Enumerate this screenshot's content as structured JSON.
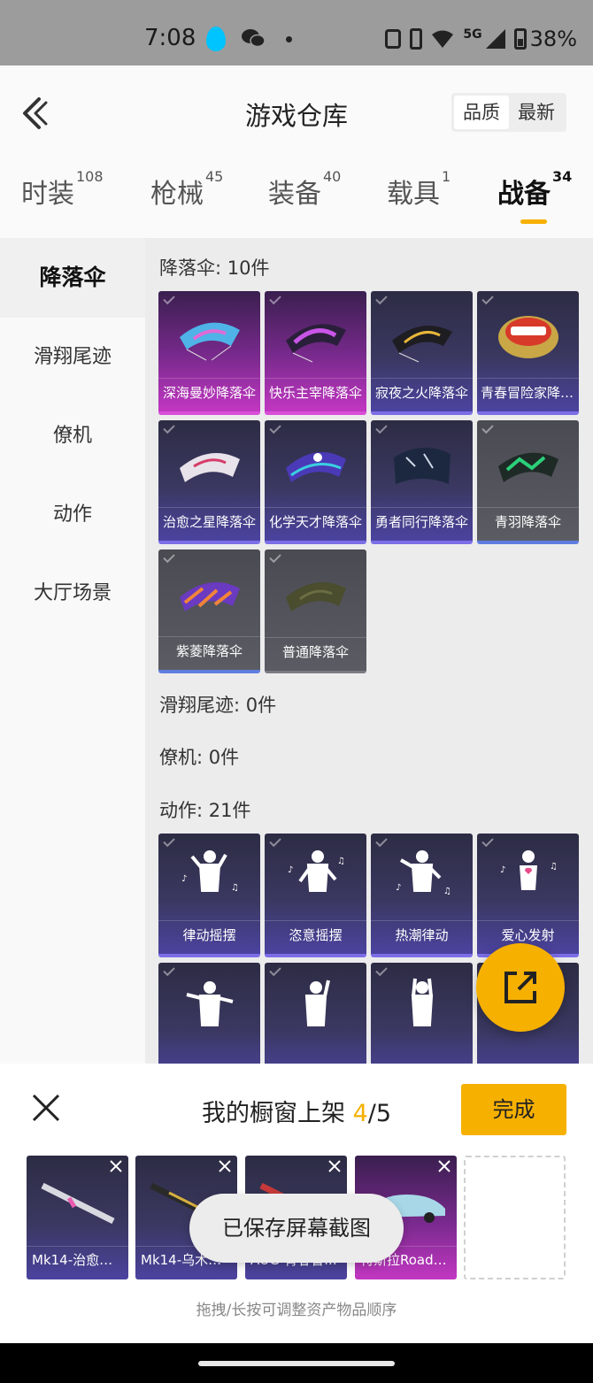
{
  "status_bar": {
    "time": "7:08",
    "network": "5G",
    "battery": "38%"
  },
  "header": {
    "title": "游戏仓库",
    "sort_options": [
      "品质",
      "最新"
    ],
    "selected_sort": "品质"
  },
  "tabs": [
    {
      "label": "时装",
      "count": "108"
    },
    {
      "label": "枪械",
      "count": "45"
    },
    {
      "label": "装备",
      "count": "40"
    },
    {
      "label": "载具",
      "count": "1"
    },
    {
      "label": "战备",
      "count": "34"
    }
  ],
  "active_tab": "战备",
  "sidebar": {
    "items": [
      "降落伞",
      "滑翔尾迹",
      "僚机",
      "动作",
      "大厅场景"
    ],
    "active": "降落伞"
  },
  "sections": {
    "parachute": {
      "title": "降落伞: 10件",
      "items": [
        "深海曼妙降落伞",
        "快乐主宰降落伞",
        "寂夜之火降落伞",
        "青春冒险家降落伞",
        "治愈之星降落伞",
        "化学天才降落伞",
        "勇者同行降落伞",
        "青羽降落伞",
        "紫菱降落伞",
        "普通降落伞"
      ]
    },
    "glide_trail": {
      "title": "滑翔尾迹: 0件"
    },
    "wingman": {
      "title": "僚机: 0件"
    },
    "emote": {
      "title": "动作: 21件",
      "items": [
        "律动摇摆",
        "恣意摇摆",
        "热潮律动",
        "爱心发射"
      ]
    }
  },
  "colors": {
    "accent": "#f6b000",
    "card_purple": "#4b43a0",
    "card_pink": "#c237c2",
    "card_gray": "#5b5c63"
  },
  "showcase": {
    "title_prefix": "我的橱窗上架 ",
    "current": "4",
    "total": "/5",
    "done_label": "完成",
    "slots": [
      "Mk14-治愈之...",
      "Mk14-乌木金...",
      "AUG-青春冒...",
      "特斯拉Roads..."
    ],
    "hint": "拖拽/长按可调整资产物品顺序"
  },
  "toast": "已保存屏幕截图"
}
